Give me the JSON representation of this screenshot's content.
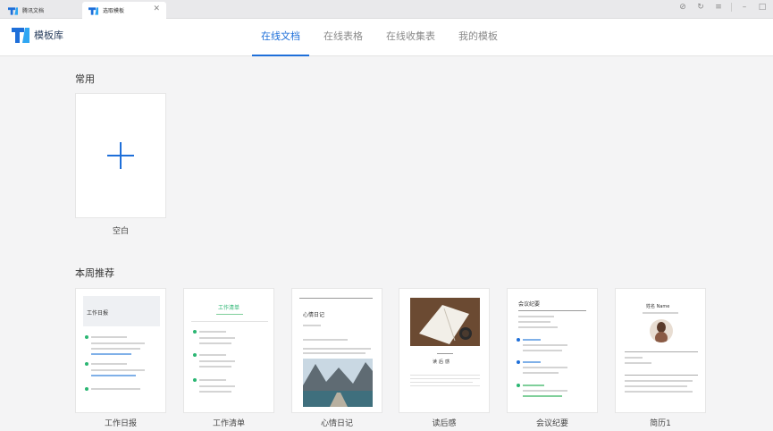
{
  "tabs": [
    {
      "label": "腾讯文档",
      "active": false
    },
    {
      "label": "选取模板",
      "active": true
    }
  ],
  "window_controls": [
    "history-icon",
    "refresh-icon",
    "menu-icon",
    "minimize-icon",
    "maximize-icon"
  ],
  "header": {
    "logo_text": "模板库",
    "nav": [
      {
        "label": "在线文档",
        "active": true
      },
      {
        "label": "在线表格",
        "active": false
      },
      {
        "label": "在线收集表",
        "active": false
      },
      {
        "label": "我的模板",
        "active": false
      }
    ]
  },
  "common": {
    "title": "常用",
    "blank_label": "空白"
  },
  "weekly": {
    "title": "本周推荐",
    "templates": [
      {
        "name": "工作日报",
        "thumb_title": "工作日报"
      },
      {
        "name": "工作清单",
        "thumb_title": "工作清单"
      },
      {
        "name": "心情日记",
        "thumb_title": "心情日记"
      },
      {
        "name": "读后感",
        "thumb_title": "读后感"
      },
      {
        "name": "会议纪要",
        "thumb_title": "会议纪要"
      },
      {
        "name": "简历1",
        "thumb_title": "姓名 Name"
      }
    ]
  },
  "colors": {
    "accent": "#1e6fd9",
    "background": "#f4f4f5"
  }
}
